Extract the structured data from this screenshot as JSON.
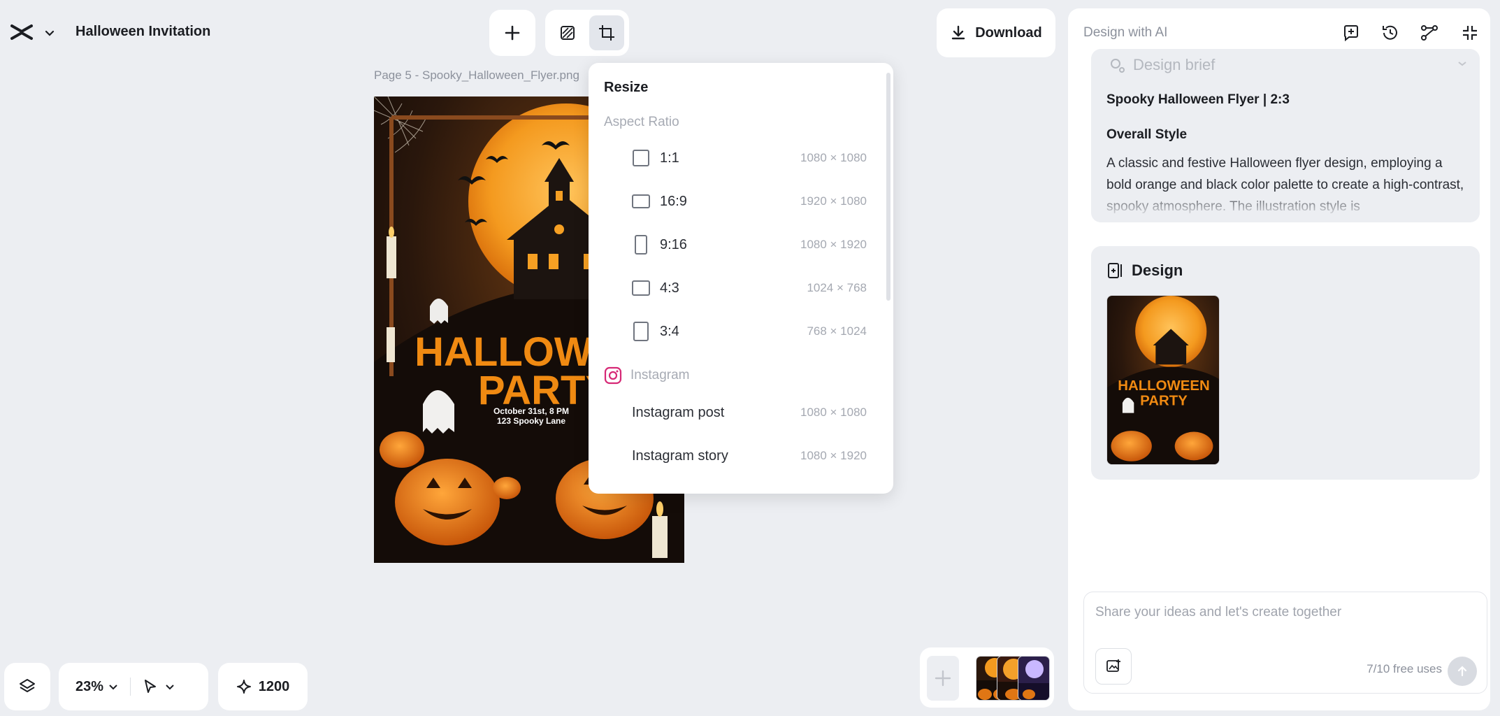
{
  "app": {
    "title": "Halloween Invitation"
  },
  "toolbar": {
    "download_label": "Download"
  },
  "canvas": {
    "page_label": "Page 5 -  Spooky_Halloween_Flyer.png",
    "poster": {
      "title_line1": "HALLOWEEN",
      "title_line2": "PARTY",
      "date_line": "October 31st, 8 PM",
      "address_line": "123 Spooky Lane"
    }
  },
  "resize_menu": {
    "title": "Resize",
    "aspect_section": "Aspect Ratio",
    "ratios": [
      {
        "label": "1:1",
        "dims": "1080 × 1080"
      },
      {
        "label": "16:9",
        "dims": "1920 × 1080"
      },
      {
        "label": "9:16",
        "dims": "1080 × 1920"
      },
      {
        "label": "4:3",
        "dims": "1024 × 768"
      },
      {
        "label": "3:4",
        "dims": "768 × 1024"
      }
    ],
    "instagram_section": "Instagram",
    "instagram_items": [
      {
        "label": "Instagram post",
        "dims": "1080 × 1080"
      },
      {
        "label": "Instagram story",
        "dims": "1080 × 1920"
      }
    ]
  },
  "ai_panel": {
    "title": "Design with AI",
    "brief": {
      "heading": "Design brief",
      "subtitle": "Spooky Halloween Flyer | 2:3",
      "style_heading": "Overall Style",
      "style_text": "A classic and festive Halloween flyer design, employing a bold orange and black color palette to create a high-contrast, spooky atmosphere. The illustration style is"
    },
    "design": {
      "heading": "Design"
    },
    "input": {
      "placeholder": "Share your ideas and let's create together",
      "free_uses": "7/10 free uses"
    }
  },
  "bottom_bar": {
    "zoom": "23%",
    "credits": "1200"
  },
  "colors": {
    "accent_orange": "#f08a12",
    "bg": "#eceef2",
    "instagram": "#d62976"
  }
}
